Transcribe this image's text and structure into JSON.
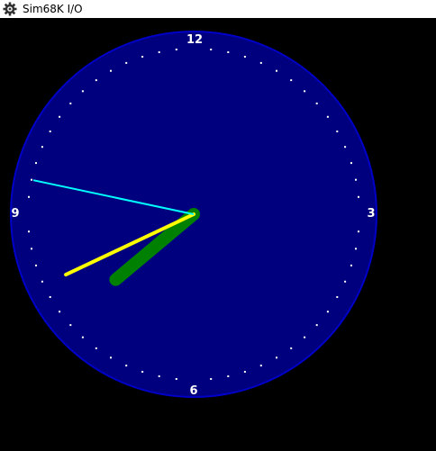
{
  "window": {
    "title": "Sim68K I/O",
    "icon": "gear-icon"
  },
  "clock": {
    "numerals": {
      "twelve": "12",
      "three": "3",
      "six": "6",
      "nine": "9"
    },
    "time": {
      "hour": 7,
      "minute": 40,
      "second": 47
    },
    "colors": {
      "background": "#000000",
      "face": "#00007f",
      "face_border": "#0000c8",
      "tick": "#ffffff",
      "numerals": "#ffffff",
      "hour_hand": "#008000",
      "minute_hand": "#ffff00",
      "second_hand": "#00ffff"
    }
  }
}
